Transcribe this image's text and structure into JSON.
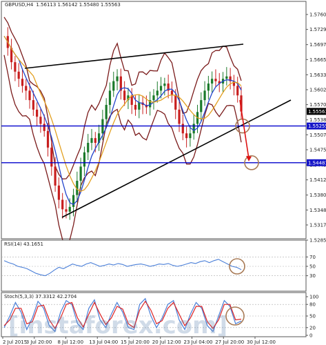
{
  "chart_data": {
    "type": "candlestick",
    "symbol": "GBPUSD,H4",
    "ohlc_header": "1.56113  1.56142  1.55480  1.55563",
    "price_ticks": [
      "1.57605",
      "1.57290",
      "1.56970",
      "1.56655",
      "1.56335",
      "1.56020",
      "1.55705",
      "1.55385",
      "1.55070",
      "1.54755",
      "1.54435",
      "1.54120",
      "1.53800",
      "1.53485",
      "1.53170",
      "1.52850"
    ],
    "last_price": "1.55563",
    "support_levels": [
      {
        "label": "1.55255",
        "value": 1.55255
      },
      {
        "label": "1.54481",
        "value": 1.54481
      }
    ],
    "time_labels": [
      "2 Jul 2015",
      "3 Jul 20:00",
      "8 Jul 12:00",
      "13 Jul 04:00",
      "15 Jul 20:00",
      "20 Jul 12:00",
      "23 Jul 04:00",
      "27 Jul 20:00",
      "30 Jul 12:00"
    ],
    "close_path": [
      1.5715,
      1.569,
      1.566,
      1.564,
      1.5625,
      1.561,
      1.56,
      1.558,
      1.556,
      1.5545,
      1.553,
      1.5515,
      1.548,
      1.544,
      1.54,
      1.537,
      1.535,
      1.5345,
      1.5355,
      1.538,
      1.541,
      1.544,
      1.547,
      1.549,
      1.55,
      1.549,
      1.551,
      1.554,
      1.557,
      1.56,
      1.562,
      1.563,
      1.56,
      1.558,
      1.559,
      1.557,
      1.556,
      1.5575,
      1.557,
      1.5565,
      1.558,
      1.559,
      1.56,
      1.561,
      1.5615,
      1.56,
      1.559,
      1.556,
      1.553,
      1.551,
      1.55,
      1.551,
      1.553,
      1.5555,
      1.558,
      1.56,
      1.5615,
      1.5625,
      1.562,
      1.5615,
      1.5625,
      1.563,
      1.562,
      1.561,
      1.559,
      1.5556
    ],
    "rsi": {
      "label": "RSI(14) 43.1651",
      "levels": [
        "70",
        "50",
        "30"
      ],
      "values": [
        62,
        58,
        55,
        50,
        48,
        45,
        40,
        35,
        32,
        30,
        35,
        42,
        48,
        45,
        50,
        55,
        52,
        50,
        55,
        58,
        54,
        50,
        52,
        55,
        53,
        56,
        54,
        50,
        52,
        54,
        55,
        53,
        50,
        52,
        55,
        54,
        56,
        52,
        50,
        52,
        55,
        58,
        56,
        60,
        62,
        58,
        62,
        65,
        60,
        55,
        50,
        48,
        43
      ]
    },
    "stoch": {
      "label": "Stoch(5,3,3) 37.3312 42.2704",
      "levels": [
        "100",
        "80",
        "50",
        "20",
        "0"
      ],
      "main": [
        20,
        50,
        85,
        60,
        15,
        45,
        88,
        70,
        25,
        10,
        60,
        90,
        80,
        30,
        15,
        70,
        92,
        40,
        20,
        55,
        85,
        60,
        20,
        15,
        80,
        95,
        50,
        20,
        45,
        80,
        90,
        40,
        15,
        55,
        85,
        70,
        25,
        10,
        50,
        90,
        75,
        30,
        37
      ],
      "signal": [
        25,
        40,
        70,
        70,
        30,
        35,
        75,
        78,
        40,
        18,
        45,
        80,
        85,
        45,
        22,
        55,
        85,
        55,
        28,
        45,
        75,
        68,
        30,
        20,
        65,
        88,
        65,
        30,
        38,
        70,
        85,
        55,
        25,
        45,
        75,
        75,
        35,
        18,
        40,
        80,
        80,
        40,
        42
      ]
    },
    "watermark": "[instaforex.com]"
  }
}
